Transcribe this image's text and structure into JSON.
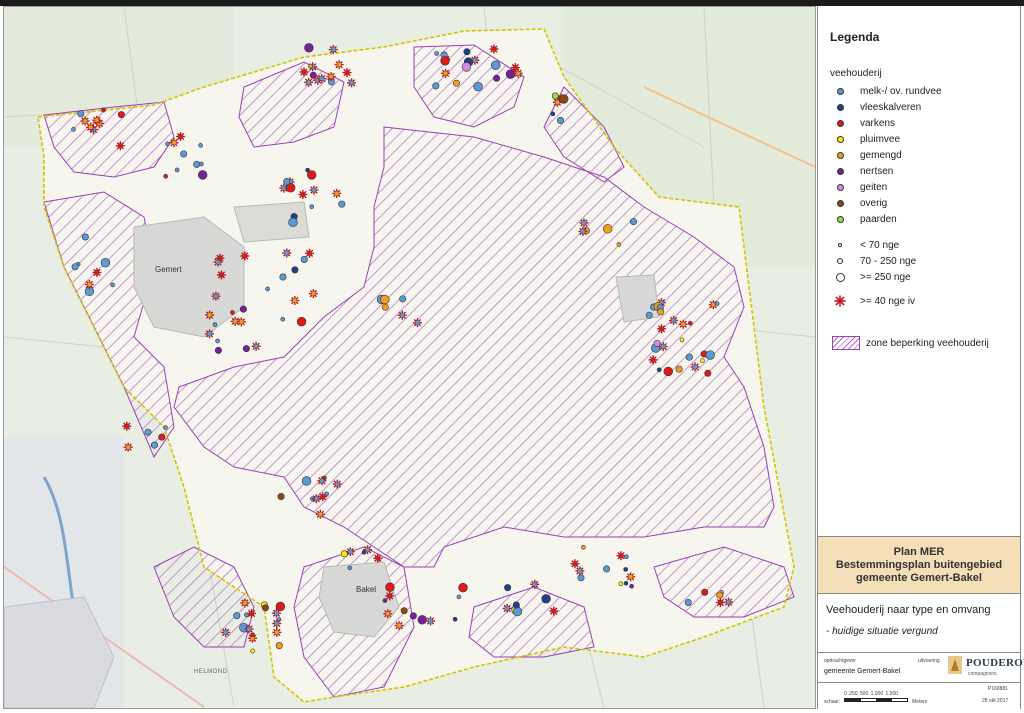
{
  "legend": {
    "title": "Legenda",
    "category_heading": "veehouderij",
    "types": [
      {
        "label": "melk-/ ov. rundvee",
        "color": "#5b9bd5",
        "icon": "circle-marker"
      },
      {
        "label": "vleeskalveren",
        "color": "#1f3f8f",
        "icon": "circle-marker"
      },
      {
        "label": "varkens",
        "color": "#e0191b",
        "icon": "circle-marker"
      },
      {
        "label": "pluimvee",
        "color": "#ffee00",
        "icon": "circle-marker"
      },
      {
        "label": "gemengd",
        "color": "#f39c1e",
        "icon": "circle-marker"
      },
      {
        "label": "nertsen",
        "color": "#7a1f9c",
        "icon": "circle-marker"
      },
      {
        "label": "geiten",
        "color": "#d98be0",
        "icon": "circle-marker"
      },
      {
        "label": "overig",
        "color": "#8b4a12",
        "icon": "circle-marker"
      },
      {
        "label": "paarden",
        "color": "#8fe03a",
        "icon": "circle-marker"
      }
    ],
    "sizes": [
      {
        "label": "< 70 nge",
        "icon": "small-circle"
      },
      {
        "label": "70 - 250 nge",
        "icon": "medium-circle"
      },
      {
        "label": ">= 250 nge",
        "icon": "large-circle"
      }
    ],
    "star_label": ">= 40 nge iv",
    "star_color": "#c0141a",
    "zone_label": "zone beperking veehouderij",
    "zone_color": "#a855c8"
  },
  "title_block": {
    "line1": "Plan MER",
    "line2": "Bestemmingsplan buitengebied",
    "line3": "gemeente Gemert-Bakel",
    "subtitle": "Veehouderij naar type en omvang",
    "note": "- huidige situatie vergund",
    "client_label": "opdrachtgever",
    "client": "gemeente Gemert-Bakel",
    "contractor_label": "uitvoering",
    "company": "POUDEROYEN",
    "company_sub": "compagnons",
    "project_number": "P168881",
    "date": "28 okt 2017",
    "scale_label": "schaal:",
    "scale_ticks": "0  250  500    1.000     1.500",
    "scale_unit": "Meters"
  },
  "map": {
    "towns": [
      "Gemert",
      "Bakel",
      "HELMOND"
    ],
    "colors": {
      "boundary": "#d4c400",
      "zone": "#9b3fb5"
    }
  }
}
